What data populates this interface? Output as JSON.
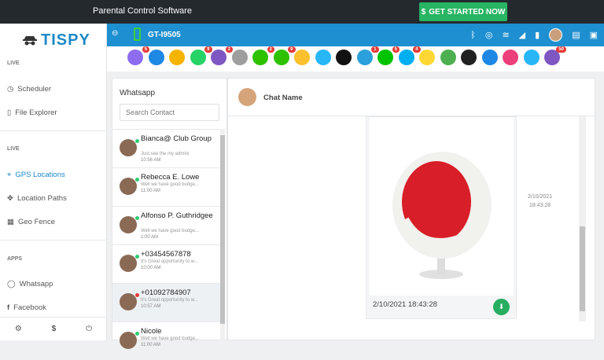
{
  "topbar": {
    "title": "Parental Control Software",
    "cta": "GET STARTED NOW"
  },
  "brand": {
    "name": "TISPY",
    "accent": "#1e88c8"
  },
  "sidebar": {
    "sections": [
      "LIVE",
      "LIVE",
      "APPS"
    ],
    "items": [
      "Scheduler",
      "File Explorer",
      "GPS Locations",
      "Location Paths",
      "Geo Fence",
      "Whatsapp",
      "Facebook"
    ]
  },
  "device": {
    "model": "GT-I9505"
  },
  "apps": [
    {
      "color": "#8e6cf0",
      "badge": "5"
    },
    {
      "color": "#1e88e5",
      "badge": ""
    },
    {
      "color": "#f4b400",
      "badge": ""
    },
    {
      "color": "#25d366",
      "badge": "9"
    },
    {
      "color": "#7e57c2",
      "badge": "2"
    },
    {
      "color": "#9e9e9e",
      "badge": ""
    },
    {
      "color": "#2dc100",
      "badge": "2"
    },
    {
      "color": "#2dc100",
      "badge": "9"
    },
    {
      "color": "#fbc02d",
      "badge": ""
    },
    {
      "color": "#29b6f6",
      "badge": ""
    },
    {
      "color": "#111111",
      "badge": ""
    },
    {
      "color": "#2aa1da",
      "badge": "1"
    },
    {
      "color": "#00c300",
      "badge": "5"
    },
    {
      "color": "#00aff0",
      "badge": "4"
    },
    {
      "color": "#fdd835",
      "badge": ""
    },
    {
      "color": "#4caf50",
      "badge": ""
    },
    {
      "color": "#212121",
      "badge": ""
    },
    {
      "color": "#1e88e5",
      "badge": ""
    },
    {
      "color": "#ec407a",
      "badge": ""
    },
    {
      "color": "#29b6f6",
      "badge": ""
    },
    {
      "color": "#7e57c2",
      "badge": "50"
    }
  ],
  "contacts": {
    "header": "Whatsapp",
    "search_placeholder": "Search Contact",
    "list": [
      {
        "name": "Bianca@ Club Group",
        "preview": "Just see the my admini",
        "time": "10:56 AM",
        "status": "#2ecc71"
      },
      {
        "name": "Rebecca E. Lowe",
        "preview": "Well we have good budge...",
        "time": "11:00 AM",
        "status": "#2ecc71"
      },
      {
        "name": "Alfonso P. Guthridgee",
        "preview": "Well we have good budge...",
        "time": "1:00 AM",
        "status": "#2ecc71"
      },
      {
        "name": "+03454567878",
        "preview": "It's Great opportunity to w...",
        "time": "10:00 AM",
        "status": "#2ecc71"
      },
      {
        "name": "+01092784907",
        "preview": "It's Great opportunity to w...",
        "time": "10:57 AM",
        "status": "#e53935"
      },
      {
        "name": "Nicole",
        "preview": "Well we have good budge...",
        "time": "11:00 AM",
        "status": "#2ecc71"
      }
    ]
  },
  "chat": {
    "name": "Chat Name",
    "message_time": "2/10/2021 18:43:28",
    "side_date": "2/10/2021",
    "side_time": "18:43:28"
  }
}
